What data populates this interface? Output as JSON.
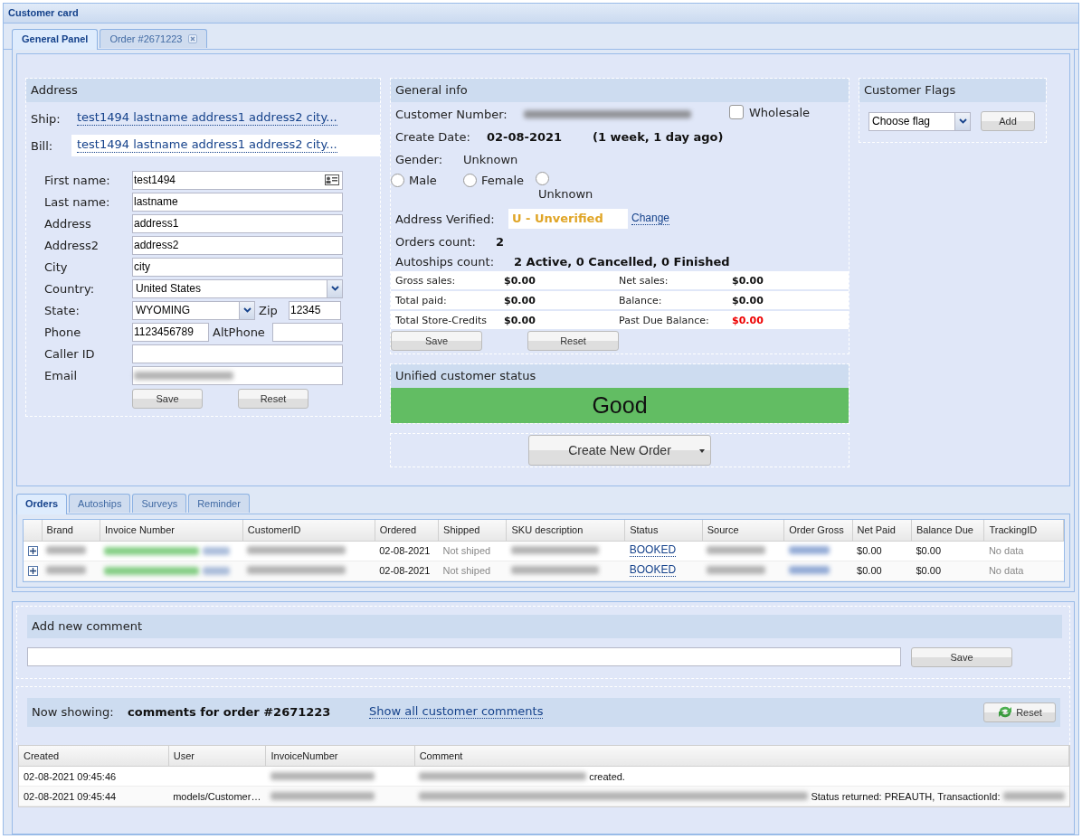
{
  "window": {
    "title": "Customer card"
  },
  "tabs": [
    {
      "label": "General Panel",
      "selected": true,
      "closable": false
    },
    {
      "label": "Order #2671223",
      "selected": false,
      "closable": true
    }
  ],
  "address": {
    "title": "Address",
    "ship_label": "Ship:",
    "ship_value": "test1494 lastname address1 address2 city...",
    "bill_label": "Bill:",
    "bill_value": "test1494 lastname address1 address2 city...",
    "fields": [
      {
        "kind": "card",
        "label": "First name:",
        "value": "test1494"
      },
      {
        "kind": "text",
        "label": "Last name:",
        "value": "lastname"
      },
      {
        "kind": "text",
        "label": "Address",
        "value": "address1"
      },
      {
        "kind": "text",
        "label": "Address2",
        "value": "address2"
      },
      {
        "kind": "text",
        "label": "City",
        "value": "city"
      },
      {
        "kind": "select",
        "label": "Country:",
        "value": "United States"
      },
      {
        "kind": "select_pair",
        "label": "State:",
        "value": "WYOMING",
        "label2": "Zip",
        "value2": "12345"
      },
      {
        "kind": "pair",
        "label": "Phone",
        "value": "1123456789",
        "label2": "AltPhone"
      },
      {
        "kind": "text",
        "label": "Caller ID"
      },
      {
        "kind": "blurred",
        "label": "Email"
      }
    ],
    "buttons": [
      "Save",
      "Reset"
    ]
  },
  "general_info": {
    "title": "General info",
    "customer_number_label": "Customer Number:",
    "wholesale": {
      "label": "Wholesale",
      "checked": false
    },
    "create_date_label": "Create Date:",
    "create_date": "02-08-2021",
    "create_date_ago": "(1 week, 1 day ago)",
    "gender_label": "Gender:",
    "gender_value": "Unknown",
    "gender_options": [
      {
        "label": "Male",
        "selected": false
      },
      {
        "label": "Female",
        "selected": false
      },
      {
        "label": "Unknown",
        "selected": false
      }
    ],
    "address_verified_label": "Address Verified:",
    "address_verified_value": "U - Unverified",
    "change_link": "Change",
    "orders_count_label": "Orders count:",
    "orders_count": "2",
    "autoships_label": "Autoships count:",
    "autoships_value": "2 Active, 0 Cancelled, 0 Finished",
    "totals": [
      {
        "label": "Gross sales:",
        "value": "$0.00",
        "alert": false
      },
      {
        "label": "Net sales:",
        "value": "$0.00",
        "alert": false
      },
      {
        "label": "Total paid:",
        "value": "$0.00",
        "alert": false
      },
      {
        "label": "Balance:",
        "value": "$0.00",
        "alert": false
      },
      {
        "label": "Total Store-Credits",
        "value": "$0.00",
        "alert": false
      },
      {
        "label": "Past Due Balance:",
        "value": "$0.00",
        "alert": true
      }
    ],
    "buttons": [
      "Save",
      "Reset"
    ]
  },
  "status": {
    "title": "Unified customer status",
    "value": "Good"
  },
  "create_order": {
    "label": "Create New Order"
  },
  "flags": {
    "title": "Customer Flags",
    "placeholder": "Choose flag",
    "button": "Add"
  },
  "order_tabs": [
    {
      "label": "Orders",
      "selected": true
    },
    {
      "label": "Autoships",
      "selected": false
    },
    {
      "label": "Surveys",
      "selected": false
    },
    {
      "label": "Reminder",
      "selected": false
    }
  ],
  "orders": {
    "columns": [
      "Brand",
      "Invoice Number",
      "CustomerID",
      "Ordered",
      "Shipped",
      "SKU description",
      "Status",
      "Source",
      "Order Gross",
      "Net Paid",
      "Balance Due",
      "TrackingID"
    ],
    "rows": [
      {
        "expanded": false,
        "cells": [
          {
            "kind": "blurred"
          },
          {
            "kind": "blurred_green"
          },
          {
            "kind": "blurred"
          },
          {
            "kind": "text",
            "text": "02-08-2021"
          },
          {
            "kind": "muted",
            "text": "Not shiped"
          },
          {
            "kind": "blurred"
          },
          {
            "kind": "link",
            "text": "BOOKED"
          },
          {
            "kind": "blurred"
          },
          {
            "kind": "blurred_link"
          },
          {
            "kind": "text",
            "text": "$0.00"
          },
          {
            "kind": "text",
            "text": "$0.00"
          },
          {
            "kind": "muted",
            "text": "No data"
          }
        ]
      },
      {
        "expanded": false,
        "cells": [
          {
            "kind": "blurred"
          },
          {
            "kind": "blurred_green"
          },
          {
            "kind": "blurred"
          },
          {
            "kind": "text",
            "text": "02-08-2021"
          },
          {
            "kind": "muted",
            "text": "Not shiped"
          },
          {
            "kind": "blurred"
          },
          {
            "kind": "link",
            "text": "BOOKED"
          },
          {
            "kind": "blurred"
          },
          {
            "kind": "blurred_link"
          },
          {
            "kind": "text",
            "text": "$0.00"
          },
          {
            "kind": "text",
            "text": "$0.00"
          },
          {
            "kind": "muted",
            "text": "No data"
          }
        ]
      }
    ]
  },
  "comments": {
    "title": "Add new comment",
    "save_button": "Save",
    "now_showing_label": "Now showing:",
    "now_showing_value": "comments for order #2671223",
    "show_all_link": "Show all customer comments",
    "reset_button": "Reset",
    "columns": [
      "Created",
      "User",
      "InvoiceNumber",
      "Comment"
    ],
    "rows": [
      {
        "created": "02-08-2021 09:45:46",
        "comment": [
          {
            "kind": "blurred"
          },
          {
            "kind": "text",
            "text": "created."
          }
        ]
      },
      {
        "created": "02-08-2021 09:45:44",
        "user": "models/Customer…",
        "comment": [
          {
            "kind": "blurred"
          },
          {
            "kind": "text",
            "text": "Status returned: PREAUTH, TransactionId:"
          },
          {
            "kind": "blurred"
          }
        ]
      }
    ]
  }
}
